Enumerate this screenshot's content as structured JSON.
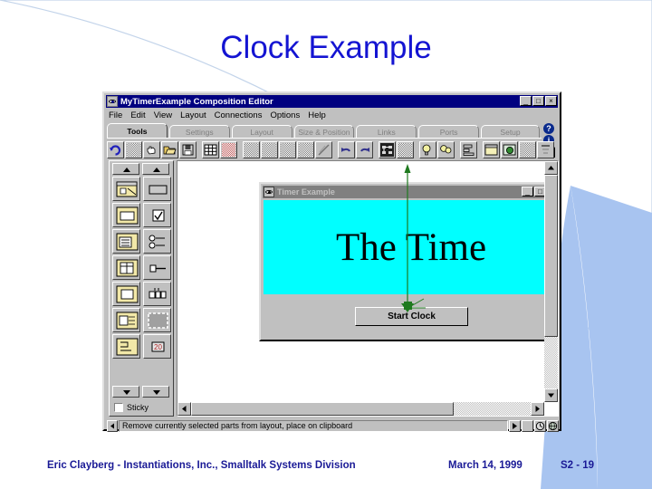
{
  "slide": {
    "title": "Clock Example",
    "title_color": "#1414d2",
    "background_accent": "#a8c4f0",
    "footer": {
      "author": "Eric Clayberg - Instantiations, Inc., Smalltalk Systems Division",
      "date": "March 14, 1999",
      "page": "S2 - 19"
    }
  },
  "app_window": {
    "icon": "eye-app-icon",
    "title": "MyTimerExample   Composition Editor",
    "window_buttons": [
      {
        "name": "minimize",
        "glyph": "_"
      },
      {
        "name": "maximize",
        "glyph": "□"
      },
      {
        "name": "close",
        "glyph": "×"
      }
    ],
    "menu": [
      "File",
      "Edit",
      "View",
      "Layout",
      "Connections",
      "Options",
      "Help"
    ],
    "tabs": [
      {
        "label": "Tools",
        "active": true
      },
      {
        "label": "Settings",
        "active": false
      },
      {
        "label": "Layout",
        "active": false
      },
      {
        "label": "Size & Position",
        "active": false
      },
      {
        "label": "Links",
        "active": false
      },
      {
        "label": "Ports",
        "active": false
      },
      {
        "label": "Setup",
        "active": false
      }
    ],
    "help_buttons": [
      {
        "name": "help-question-icon",
        "glyph": "?"
      },
      {
        "name": "info-icon",
        "glyph": "i"
      },
      {
        "name": "flag-icon",
        "glyph": ""
      }
    ],
    "toolbar": [
      {
        "name": "refresh-icon",
        "kind": "refresh"
      },
      {
        "name": "new-icon",
        "kind": "dither"
      },
      {
        "name": "hand-icon",
        "kind": "hand"
      },
      {
        "name": "open-folder-icon",
        "kind": "folder"
      },
      {
        "name": "save-disk-icon",
        "kind": "disk"
      },
      {
        "name": "grid-icon",
        "kind": "grid"
      },
      {
        "name": "grid-red-icon",
        "kind": "grid-red"
      },
      {
        "name": "cut-icon",
        "kind": "dither"
      },
      {
        "name": "copy-icon",
        "kind": "dither"
      },
      {
        "name": "paste-icon",
        "kind": "dither"
      },
      {
        "name": "duplicate-icon",
        "kind": "dither"
      },
      {
        "name": "delete-icon",
        "kind": "dither"
      },
      {
        "name": "undo-icon",
        "kind": "undo"
      },
      {
        "name": "redo-icon",
        "kind": "redo"
      },
      {
        "name": "connections-icon",
        "kind": "dark"
      },
      {
        "name": "break-connections-icon",
        "kind": "dither"
      },
      {
        "name": "bulb-icon",
        "kind": "bulb"
      },
      {
        "name": "bulb-two-icon",
        "kind": "bulb"
      },
      {
        "name": "align-icon",
        "kind": "align"
      },
      {
        "name": "window-icon",
        "kind": "window"
      },
      {
        "name": "preview-icon",
        "kind": "preview"
      },
      {
        "name": "select-all-icon",
        "kind": "dither"
      },
      {
        "name": "properties-icon",
        "kind": "props"
      }
    ],
    "palette": {
      "scroll_up_label": "",
      "scroll_down_label": "",
      "items": [
        {
          "name": "palette-window-tool",
          "col": 1
        },
        {
          "name": "palette-label-tool",
          "col": 2
        },
        {
          "name": "palette-group-tool",
          "col": 1
        },
        {
          "name": "palette-checkbox-tool",
          "col": 2
        },
        {
          "name": "palette-list-tool",
          "col": 1
        },
        {
          "name": "palette-radio-list-tool",
          "col": 2
        },
        {
          "name": "palette-table-tool",
          "col": 1
        },
        {
          "name": "palette-slider-tool",
          "col": 2
        },
        {
          "name": "palette-panel-tool",
          "col": 1
        },
        {
          "name": "palette-spinner-tool",
          "col": 2
        },
        {
          "name": "palette-notebook-tool",
          "col": 1
        },
        {
          "name": "palette-selection-tool",
          "col": 2
        },
        {
          "name": "palette-flow-tool",
          "col": 1
        },
        {
          "name": "palette-number-tool",
          "col": 2
        }
      ],
      "sticky_label": "Sticky",
      "sticky_checked": false
    },
    "preview_window": {
      "icon": "eye-app-icon",
      "title": "Timer Example",
      "window_buttons": [
        {
          "name": "minimize",
          "glyph": "_"
        },
        {
          "name": "maximize",
          "glyph": "□"
        },
        {
          "name": "close",
          "glyph": "×"
        }
      ],
      "display_text": "The Time",
      "display_background": "#00ffff",
      "button_label": "Start Clock"
    },
    "connection": {
      "color": "#1f7a1f",
      "name": "event-connection-arrow"
    },
    "status_bar": {
      "text": "Remove currently selected parts from layout, place on clipboard",
      "icons": [
        {
          "name": "status-play-icon"
        },
        {
          "name": "status-dither-icon"
        },
        {
          "name": "status-clock-icon"
        },
        {
          "name": "status-globe-icon"
        }
      ]
    }
  }
}
